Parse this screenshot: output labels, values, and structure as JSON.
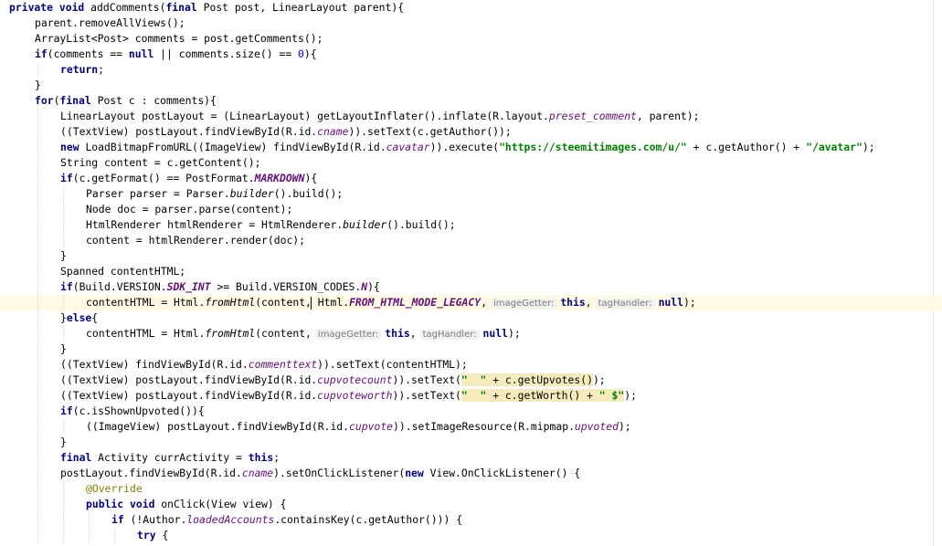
{
  "editor": {
    "caret_line": 19,
    "lines": [
      {
        "indent": 0,
        "tokens": [
          [
            "kw",
            "private void "
          ],
          [
            "",
            "addComments("
          ],
          [
            "kw",
            "final "
          ],
          [
            "",
            "Post post, LinearLayout parent){"
          ]
        ]
      },
      {
        "indent": 1,
        "tokens": [
          [
            "",
            "parent.removeAllViews();"
          ]
        ]
      },
      {
        "indent": 1,
        "tokens": [
          [
            "",
            "ArrayList<Post> comments = post.getComments();"
          ]
        ]
      },
      {
        "indent": 1,
        "tokens": [
          [
            "kw",
            "if"
          ],
          [
            "",
            "(comments == "
          ],
          [
            "kw",
            "null"
          ],
          [
            "",
            " || comments.size() == "
          ],
          [
            "num",
            "0"
          ],
          [
            "",
            "){"
          ]
        ]
      },
      {
        "indent": 2,
        "tokens": [
          [
            "kw",
            "return"
          ],
          [
            "",
            ";"
          ]
        ]
      },
      {
        "indent": 1,
        "tokens": [
          [
            "",
            "}"
          ]
        ]
      },
      {
        "indent": 1,
        "tokens": [
          [
            "kw",
            "for"
          ],
          [
            "",
            "("
          ],
          [
            "kw",
            "final "
          ],
          [
            "",
            "Post c : comments){"
          ]
        ]
      },
      {
        "indent": 2,
        "tokens": [
          [
            "",
            "LinearLayout postLayout = (LinearLayout) getLayoutInflater().inflate(R.layout."
          ],
          [
            "fld",
            "preset_comment"
          ],
          [
            "",
            ", parent);"
          ]
        ]
      },
      {
        "indent": 2,
        "tokens": [
          [
            "",
            "((TextView) postLayout.findViewById(R.id."
          ],
          [
            "fld",
            "cname"
          ],
          [
            "",
            ")).setText(c.getAuthor());"
          ]
        ]
      },
      {
        "indent": 2,
        "tokens": [
          [
            "kw",
            "new "
          ],
          [
            "",
            "LoadBitmapFromURL((ImageView) findViewById(R.id."
          ],
          [
            "fld",
            "cavatar"
          ],
          [
            "",
            ")).execute("
          ],
          [
            "str",
            "\"https://steemitimages.com/u/\""
          ],
          [
            "",
            " + c.getAuthor() + "
          ],
          [
            "str",
            "\"/avatar\""
          ],
          [
            "",
            ");"
          ]
        ]
      },
      {
        "indent": 2,
        "tokens": [
          [
            "",
            "String content = c.getContent();"
          ]
        ]
      },
      {
        "indent": 2,
        "tokens": [
          [
            "kw",
            "if"
          ],
          [
            "",
            "(c.getFormat() == PostFormat."
          ],
          [
            "fldb",
            "MARKDOWN"
          ],
          [
            "",
            "){"
          ]
        ]
      },
      {
        "indent": 3,
        "tokens": [
          [
            "",
            "Parser parser = Parser."
          ],
          [
            "static",
            "builder"
          ],
          [
            "",
            "().build();"
          ]
        ]
      },
      {
        "indent": 3,
        "tokens": [
          [
            "",
            "Node doc = parser.parse(content);"
          ]
        ]
      },
      {
        "indent": 3,
        "tokens": [
          [
            "",
            "HtmlRenderer htmlRenderer = HtmlRenderer."
          ],
          [
            "static",
            "builder"
          ],
          [
            "",
            "().build();"
          ]
        ]
      },
      {
        "indent": 3,
        "tokens": [
          [
            "",
            "content = htmlRenderer.render(doc);"
          ]
        ]
      },
      {
        "indent": 2,
        "tokens": [
          [
            "",
            "}"
          ]
        ]
      },
      {
        "indent": 2,
        "tokens": [
          [
            "",
            "Spanned contentHTML;"
          ]
        ]
      },
      {
        "indent": 2,
        "tokens": [
          [
            "kw",
            "if"
          ],
          [
            "",
            "(Build.VERSION."
          ],
          [
            "fldb",
            "SDK_INT"
          ],
          [
            "",
            " >= Build.VERSION_CODES."
          ],
          [
            "fldb",
            "N"
          ],
          [
            "",
            "){"
          ]
        ]
      },
      {
        "indent": 3,
        "tokens": [
          [
            "",
            "contentHTML = Html."
          ],
          [
            "static",
            "fromHtml"
          ],
          [
            "",
            "(content,"
          ],
          [
            "caret",
            ""
          ],
          [
            "",
            " Html."
          ],
          [
            "fldb",
            "FROM_HTML_MODE_LEGACY"
          ],
          [
            "",
            ","
          ],
          [
            "hint",
            "imageGetter:"
          ],
          [
            "kw",
            "this"
          ],
          [
            "",
            ","
          ],
          [
            "hint",
            "tagHandler:"
          ],
          [
            "kw",
            "null"
          ],
          [
            "",
            ");"
          ]
        ]
      },
      {
        "indent": 2,
        "tokens": [
          [
            "",
            "}"
          ],
          [
            "kw",
            "else"
          ],
          [
            "",
            "{"
          ]
        ]
      },
      {
        "indent": 3,
        "tokens": [
          [
            "",
            "contentHTML = Html."
          ],
          [
            "static",
            "fromHtml"
          ],
          [
            "",
            "(content,"
          ],
          [
            "hint",
            "imageGetter:"
          ],
          [
            "kw",
            "this"
          ],
          [
            "",
            ","
          ],
          [
            "hint",
            "tagHandler:"
          ],
          [
            "kw",
            "null"
          ],
          [
            "",
            ");"
          ]
        ]
      },
      {
        "indent": 2,
        "tokens": [
          [
            "",
            "}"
          ]
        ]
      },
      {
        "indent": 2,
        "tokens": [
          [
            "",
            "((TextView) findViewById(R.id."
          ],
          [
            "fld",
            "commenttext"
          ],
          [
            "",
            ")).setText(contentHTML);"
          ]
        ]
      },
      {
        "indent": 2,
        "tokens": [
          [
            "",
            "((TextView) postLayout.findViewById(R.id."
          ],
          [
            "fld",
            "cupvotecount"
          ],
          [
            "",
            ")).setText("
          ],
          [
            "hlstr",
            "\"  \""
          ],
          [
            "hl",
            " + c.getUpvotes()"
          ],
          [
            "",
            ");"
          ]
        ]
      },
      {
        "indent": 2,
        "tokens": [
          [
            "",
            "((TextView) postLayout.findViewById(R.id."
          ],
          [
            "fld",
            "cupvoteworth"
          ],
          [
            "",
            ")).setText("
          ],
          [
            "hlstr",
            "\"  \""
          ],
          [
            "hl",
            " + c.getWorth() + "
          ],
          [
            "hlstr",
            "\" $\""
          ],
          [
            "",
            ");"
          ]
        ]
      },
      {
        "indent": 2,
        "tokens": [
          [
            "kw",
            "if"
          ],
          [
            "",
            "(c.isShownUpvoted()){"
          ]
        ]
      },
      {
        "indent": 3,
        "tokens": [
          [
            "",
            "((ImageView) postLayout.findViewById(R.id."
          ],
          [
            "fld",
            "cupvote"
          ],
          [
            "",
            ")).setImageResource(R.mipmap."
          ],
          [
            "fld",
            "upvoted"
          ],
          [
            "",
            ");"
          ]
        ]
      },
      {
        "indent": 2,
        "tokens": [
          [
            "",
            "}"
          ]
        ]
      },
      {
        "indent": 2,
        "tokens": [
          [
            "kw",
            "final "
          ],
          [
            "",
            "Activity currActivity = "
          ],
          [
            "kw",
            "this"
          ],
          [
            "",
            ";"
          ]
        ]
      },
      {
        "indent": 2,
        "tokens": [
          [
            "",
            "postLayout.findViewById(R.id."
          ],
          [
            "fld",
            "cname"
          ],
          [
            "",
            ").setOnClickListener("
          ],
          [
            "kw",
            "new "
          ],
          [
            "",
            "View.OnClickListener() {"
          ]
        ]
      },
      {
        "indent": 3,
        "tokens": [
          [
            "ann",
            "@Override"
          ]
        ]
      },
      {
        "indent": 3,
        "tokens": [
          [
            "kw",
            "public void "
          ],
          [
            "",
            "onClick(View view) {"
          ]
        ]
      },
      {
        "indent": 4,
        "tokens": [
          [
            "kw",
            "if "
          ],
          [
            "",
            "(!Author."
          ],
          [
            "fld",
            "loadedAccounts"
          ],
          [
            "",
            ".containsKey(c.getAuthor())) {"
          ]
        ]
      },
      {
        "indent": 5,
        "tokens": [
          [
            "kw",
            "try "
          ],
          [
            "",
            "{"
          ]
        ]
      }
    ]
  }
}
